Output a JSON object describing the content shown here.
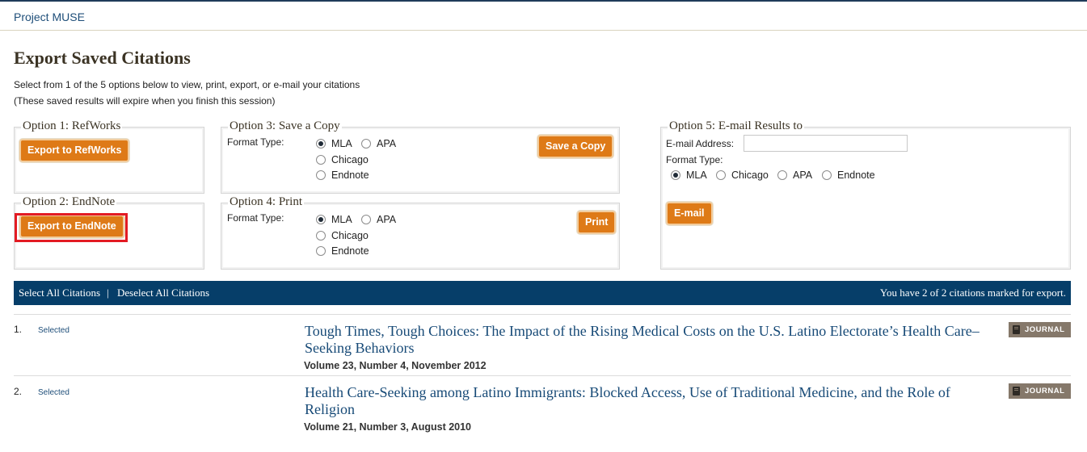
{
  "brand": "Project MUSE",
  "page_title": "Export Saved Citations",
  "intro": {
    "line1": "Select from 1 of the 5 options below to view, print, export, or e-mail your citations",
    "line2": "(These saved results will expire when you finish this session)"
  },
  "options": {
    "refworks": {
      "legend": "Option 1: RefWorks",
      "button": "Export to RefWorks"
    },
    "endnote": {
      "legend": "Option 2: EndNote",
      "button": "Export to EndNote"
    },
    "save": {
      "legend": "Option 3: Save a Copy",
      "format_label": "Format Type:",
      "formats": [
        "MLA",
        "APA",
        "Chicago",
        "Endnote"
      ],
      "selected": "MLA",
      "button": "Save a Copy"
    },
    "print": {
      "legend": "Option 4: Print",
      "format_label": "Format Type:",
      "formats": [
        "MLA",
        "APA",
        "Chicago",
        "Endnote"
      ],
      "selected": "MLA",
      "button": "Print"
    },
    "email": {
      "legend": "Option 5: E-mail Results to",
      "address_label": "E-mail Address:",
      "address_value": "",
      "format_label": "Format Type:",
      "formats": [
        "MLA",
        "Chicago",
        "APA",
        "Endnote"
      ],
      "selected": "MLA",
      "button": "E-mail"
    }
  },
  "toolbar": {
    "select_all": "Select All Citations",
    "separator": "|",
    "deselect_all": "Deselect All Citations",
    "status": "You have 2 of 2 citations marked for export."
  },
  "citations": [
    {
      "number": "1.",
      "selected_label": "Selected",
      "title": "Tough Times, Tough Choices: The Impact of the Rising Medical Costs on the U.S. Latino Electorate’s Health Care–Seeking Behaviors",
      "volume": "Volume 23, Number 4, November 2012",
      "type": "JOURNAL"
    },
    {
      "number": "2.",
      "selected_label": "Selected",
      "title": "Health Care-Seeking among Latino Immigrants: Blocked Access, Use of Traditional Medicine, and the Role of Religion",
      "volume": "Volume 21, Number 3, August 2010",
      "type": "JOURNAL"
    }
  ],
  "colors": {
    "button_orange": "#de7a17",
    "toolbar_navy": "#063e69",
    "link_blue": "#174a77",
    "highlight_red": "#e31b23",
    "badge_brown": "#85786a"
  }
}
